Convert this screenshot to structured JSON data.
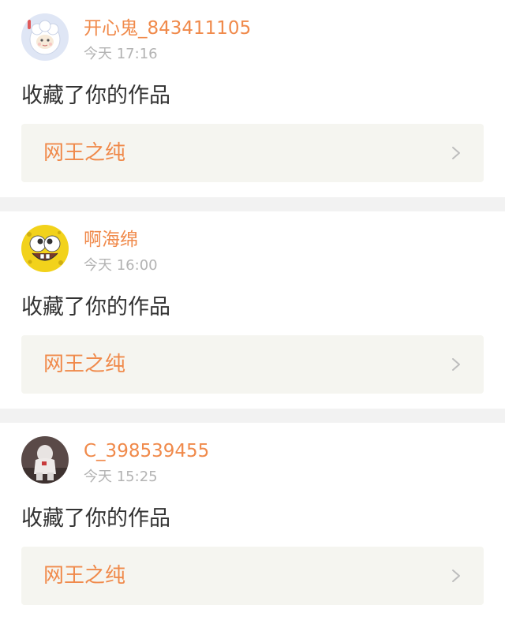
{
  "notifications": [
    {
      "username": "开心鬼_843411105",
      "time": "今天 17:16",
      "action": "收藏了你的作品",
      "work_title": "网王之纯",
      "avatar_icon": "sheep-cartoon-avatar"
    },
    {
      "username": "啊海绵",
      "time": "今天 16:00",
      "action": "收藏了你的作品",
      "work_title": "网王之纯",
      "avatar_icon": "spongebob-face-avatar"
    },
    {
      "username": "C_398539455",
      "time": "今天 15:25",
      "action": "收藏了你的作品",
      "work_title": "网王之纯",
      "avatar_icon": "photo-avatar"
    }
  ],
  "colors": {
    "accent": "#f08a4b",
    "timestamp": "#b3b3b3",
    "body_text": "#333333",
    "link_background": "#f5f5f0",
    "separator": "#f2f2f2",
    "chevron": "#bdbdbd"
  }
}
